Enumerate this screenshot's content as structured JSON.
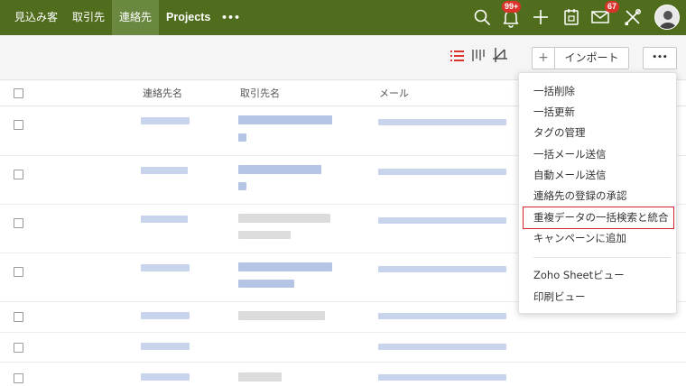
{
  "nav": {
    "tabs": [
      {
        "label": "見込み客"
      },
      {
        "label": "取引先"
      },
      {
        "label": "連絡先"
      },
      {
        "label": "Projects"
      }
    ],
    "more_label": "•••",
    "notifications_badge": "99+",
    "mail_badge": "67"
  },
  "toolbar": {
    "add_label": "+",
    "import_label": "インポート",
    "more_label": "•••"
  },
  "table": {
    "columns": [
      "連絡先名",
      "取引先名",
      "メール"
    ]
  },
  "menu": {
    "items": [
      "一括削除",
      "一括更新",
      "タグの管理",
      "一括メール送信",
      "自動メール送信",
      "連絡先の登録の承認",
      "重複データの一括検索と統合",
      "キャンペーンに追加"
    ],
    "items2": [
      "Zoho Sheetビュー",
      "印刷ビュー"
    ]
  },
  "colors": {
    "topbar": "#4f6d1d",
    "active_tab": "#6a8840",
    "badge": "#d9332b",
    "highlight_border": "#d2232a",
    "list_view_icon": "#d9332b"
  }
}
